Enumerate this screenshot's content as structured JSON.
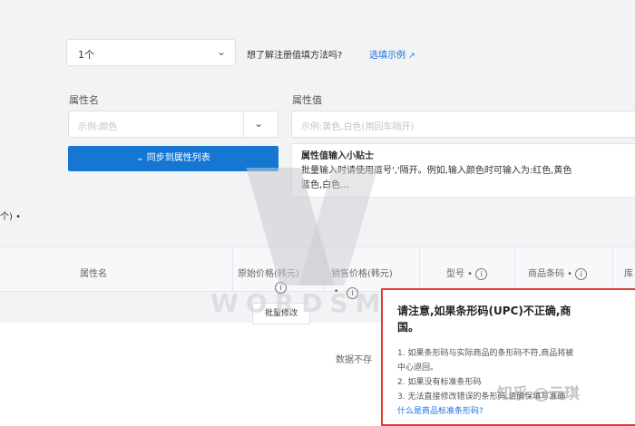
{
  "top": {
    "count_select_value": "1个",
    "question_text": "想了解注册值填方法吗?",
    "link_text": "选填示例"
  },
  "attr_name": {
    "label": "属性名",
    "placeholder": "示例:颜色"
  },
  "attr_value": {
    "label": "属性值",
    "placeholder": "示例:黄色,白色(用回车隔开)"
  },
  "sync_button": {
    "label": "同步到属性列表"
  },
  "tips": {
    "title": "属性值输入小贴士",
    "body_line1": "批量输入时请使用逗号','隔开。例如,输入颜色时可输入为:红色,黄色",
    "body_line2": "蓝色,白色…"
  },
  "side_text": "个) •",
  "table": {
    "headers": {
      "attr_name": "属性名",
      "orig_price": "原始价格(韩元)",
      "sale_price": "销售价格(韩元)",
      "model": "型号 •",
      "barcode": "商品条码 •",
      "extra": "库"
    },
    "batch_edit": "批量修改",
    "empty_text": "数据不存"
  },
  "popup": {
    "title_line1": "请注意,如果条形码(UPC)不正确,商",
    "title_line2": "国。",
    "item1_line1": "1. 如果条形码与实际商品的条形码不符,商品将被",
    "item1_line2": "中心退回。",
    "item2": "2. 如果没有标准条形码",
    "item3": "3. 无法直接修改错误的条形码,请确保填写准确",
    "item4": "什么是商品标准条形码?"
  },
  "watermark": {
    "text": "WORDSMITH",
    "overlay": "知乎 @云琪"
  },
  "colors": {
    "primary": "#1677d2",
    "link": "#1a73e8",
    "alert_border": "#e23b2e"
  }
}
